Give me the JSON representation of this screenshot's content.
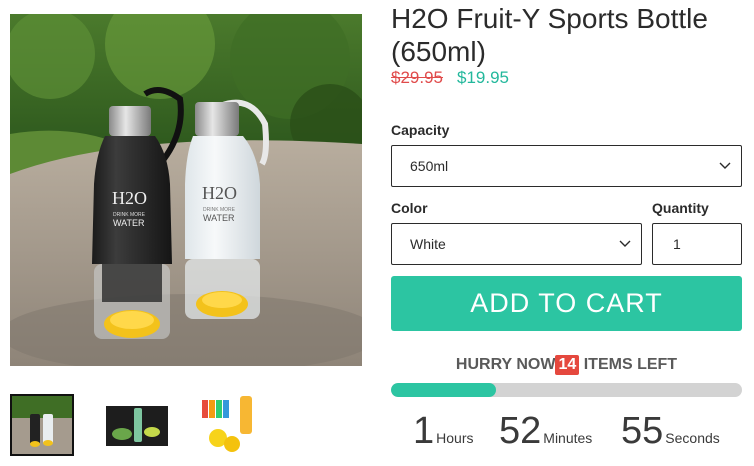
{
  "product": {
    "title": "H2O Fruit-Y Sports Bottle (650ml)",
    "price_original": "$29.95",
    "price_sale": "$19.95",
    "image_alt": "Two H2O fruit infuser sports bottles, black and white, on a pavement path",
    "bottle_print_logo": "H2O",
    "bottle_print_tagline": "DRINK MORE",
    "bottle_print_word": "WATER"
  },
  "thumbnails": [
    {
      "alt": "Black and white bottles on path",
      "selected": true
    },
    {
      "alt": "Bottle with lemons product shot",
      "selected": false
    },
    {
      "alt": "Bottle color variations with lemons",
      "selected": false
    }
  ],
  "options": {
    "capacity_label": "Capacity",
    "capacity_value": "650ml",
    "color_label": "Color",
    "color_value": "White",
    "quantity_label": "Quantity",
    "quantity_value": "1"
  },
  "cta": {
    "add_to_cart_label": "ADD TO CART"
  },
  "urgency": {
    "prefix": "HURRY NOW",
    "count": "14",
    "suffix": "ITEMS LEFT",
    "stock_fraction": 0.3
  },
  "countdown": {
    "hours": "1",
    "hours_label": "Hours",
    "minutes": "52",
    "minutes_label": "Minutes",
    "seconds": "55",
    "seconds_label": "Seconds"
  },
  "colors": {
    "accent": "#2cc5a2",
    "sale_price": "#23b89c",
    "old_price": "#e04b4b",
    "badge": "#e5483e"
  },
  "icons": {
    "select_arrow": "chevron-down-icon"
  }
}
